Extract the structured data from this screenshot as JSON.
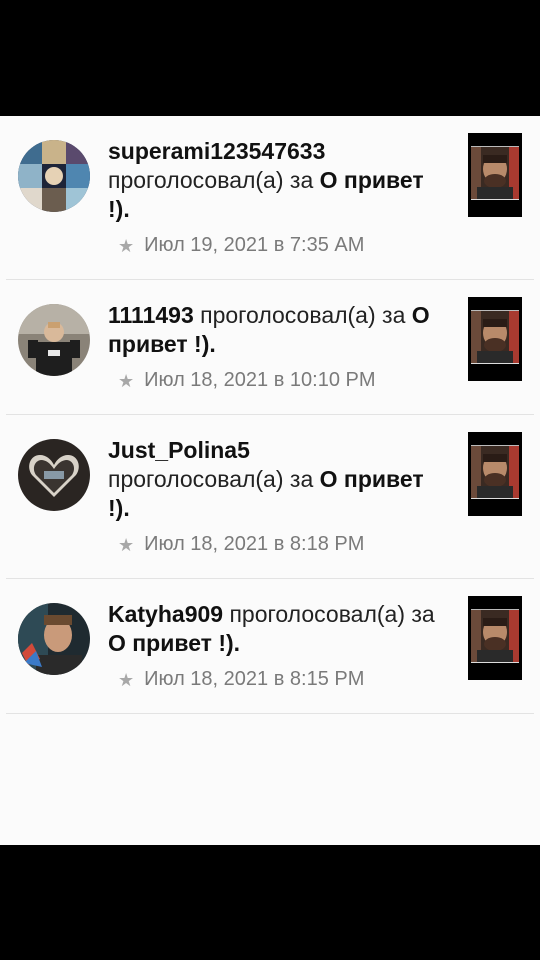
{
  "feed": [
    {
      "username": "superami123547633",
      "action": "проголосовал(а) за",
      "target": "О привет !).",
      "timestamp": "Июл 19, 2021 в 7:35 AM",
      "icon": "star-icon"
    },
    {
      "username": "1111493",
      "action": "проголосовал(а) за",
      "target": "О привет !).",
      "timestamp": "Июл 18, 2021 в 10:10 PM",
      "icon": "star-icon"
    },
    {
      "username": "Just_Polina5",
      "action": "проголосовал(а) за",
      "target": "О привет !).",
      "timestamp": "Июл 18, 2021 в 8:18 PM",
      "icon": "star-icon"
    },
    {
      "username": "Katyha909",
      "action": "проголосовал(а) за",
      "target": "О привет !).",
      "timestamp": "Июл 18, 2021 в 8:15 PM",
      "icon": "star-icon"
    }
  ],
  "colors": {
    "background": "#fbfbfb",
    "text": "#111111",
    "timestamp": "#7a7a7a",
    "divider": "#e3e3e3",
    "letterbox": "#000000"
  }
}
